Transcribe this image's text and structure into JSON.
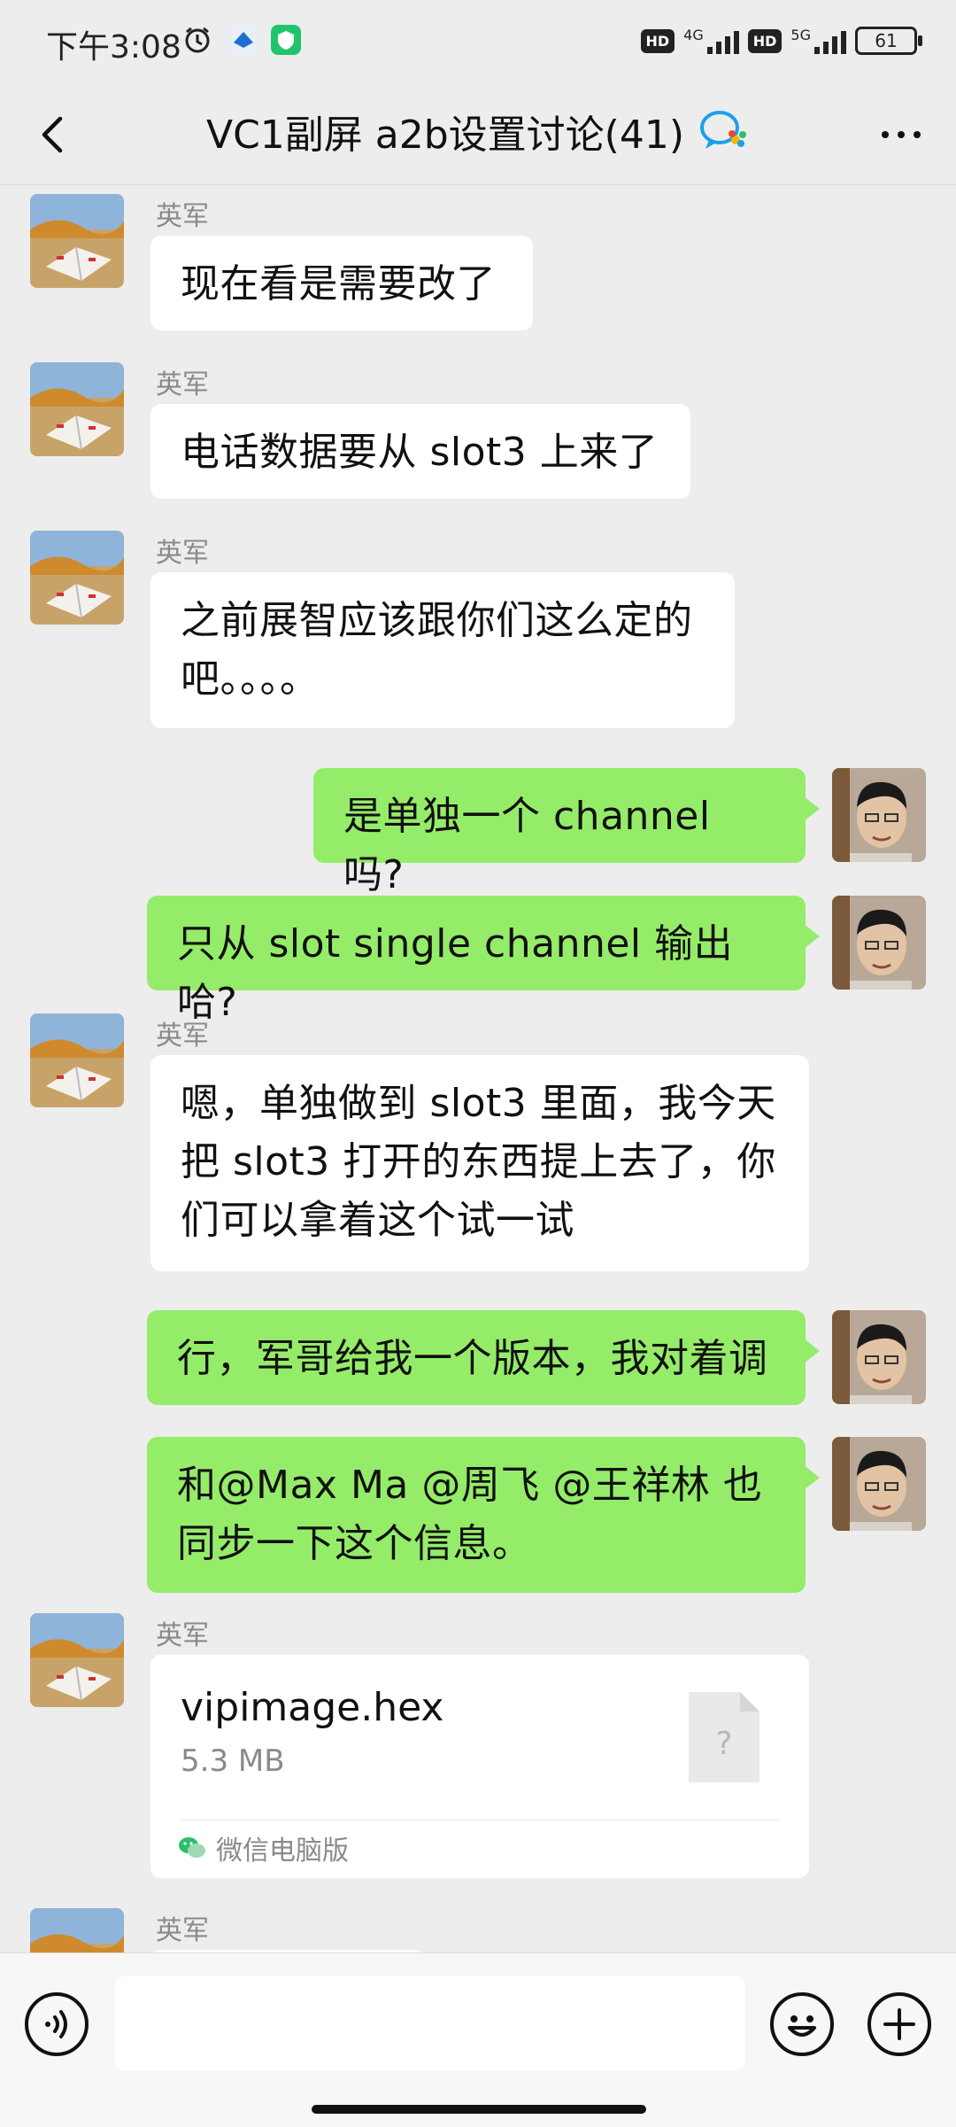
{
  "status_bar": {
    "time": "下午3:08",
    "net1": "4G",
    "net2": "5G",
    "hd1": "HD",
    "hd2": "HD",
    "battery": "61"
  },
  "header": {
    "title": "VC1副屏 a2b设置讨论(41)"
  },
  "messages": [
    {
      "side": "left",
      "sender": "英军",
      "text": "现在看是需要改了"
    },
    {
      "side": "left",
      "sender": "英军",
      "text": "电话数据要从 slot3 上来了"
    },
    {
      "side": "left",
      "sender": "英军",
      "text_line1": "之前展智应该跟你们这么定的",
      "text_line2": "吧。。。。"
    },
    {
      "side": "right",
      "text": "是单独一个 channel 吗?"
    },
    {
      "side": "right",
      "text": "只从 slot single channel 输出哈?"
    },
    {
      "side": "left",
      "sender": "英军",
      "text_line1": "嗯，单独做到 slot3 里面，我今天",
      "text_line2": "把 slot3 打开的东西提上去了，你",
      "text_line3": "们可以拿着这个试一试"
    },
    {
      "side": "right",
      "text": "行，军哥给我一个版本，我对着调"
    },
    {
      "side": "right",
      "text_line1": "和@Max Ma @周飞  @王祥林   也",
      "text_line2": "同步一下这个信息。"
    },
    {
      "side": "left",
      "sender": "英军",
      "file_name": "vipimage.hex",
      "file_size": "5.3 MB",
      "file_source": "微信电脑版"
    },
    {
      "side": "left",
      "sender": "英军"
    }
  ],
  "input": {
    "placeholder": ""
  },
  "colors": {
    "background": "#ededed",
    "own_bubble": "#95ec69",
    "other_bubble": "#ffffff",
    "wechat_blue": "#1aa0e8"
  },
  "icons": {
    "back": "chevron-left-icon",
    "more": "more-dots-icon",
    "voice": "voice-icon",
    "emoji": "emoji-icon",
    "plus": "plus-icon",
    "file": "unknown-file-icon",
    "source": "wechat-pc-icon"
  }
}
